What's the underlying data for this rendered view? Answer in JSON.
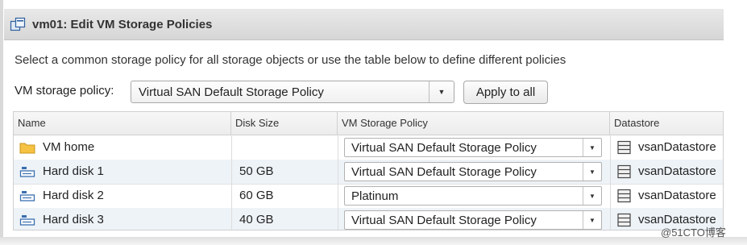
{
  "dialog": {
    "title": "vm01: Edit VM Storage Policies"
  },
  "instructions": "Select a common storage policy for all storage objects or use the table below to define different policies",
  "policy_selector": {
    "label": "VM storage policy:",
    "selected": "Virtual SAN Default Storage Policy",
    "apply_label": "Apply to all"
  },
  "table": {
    "columns": [
      "Name",
      "Disk Size",
      "VM Storage Policy",
      "Datastore"
    ],
    "rows": [
      {
        "name": "VM home",
        "icon": "folder-icon",
        "size": "",
        "policy": "Virtual SAN Default Storage Policy",
        "datastore": "vsanDatastore"
      },
      {
        "name": "Hard disk 1",
        "icon": "hard-disk-icon",
        "size": "50 GB",
        "policy": "Virtual SAN Default Storage Policy",
        "datastore": "vsanDatastore"
      },
      {
        "name": "Hard disk 2",
        "icon": "hard-disk-icon",
        "size": "60 GB",
        "policy": "Platinum",
        "datastore": "vsanDatastore"
      },
      {
        "name": "Hard disk 3",
        "icon": "hard-disk-icon",
        "size": "40 GB",
        "policy": "Virtual SAN Default Storage Policy",
        "datastore": "vsanDatastore"
      }
    ]
  },
  "watermark": "@51CTO博客",
  "colors": {
    "row_alt": "#eef3f8",
    "folder": "#f5c242",
    "disk": "#3a6fb0"
  }
}
